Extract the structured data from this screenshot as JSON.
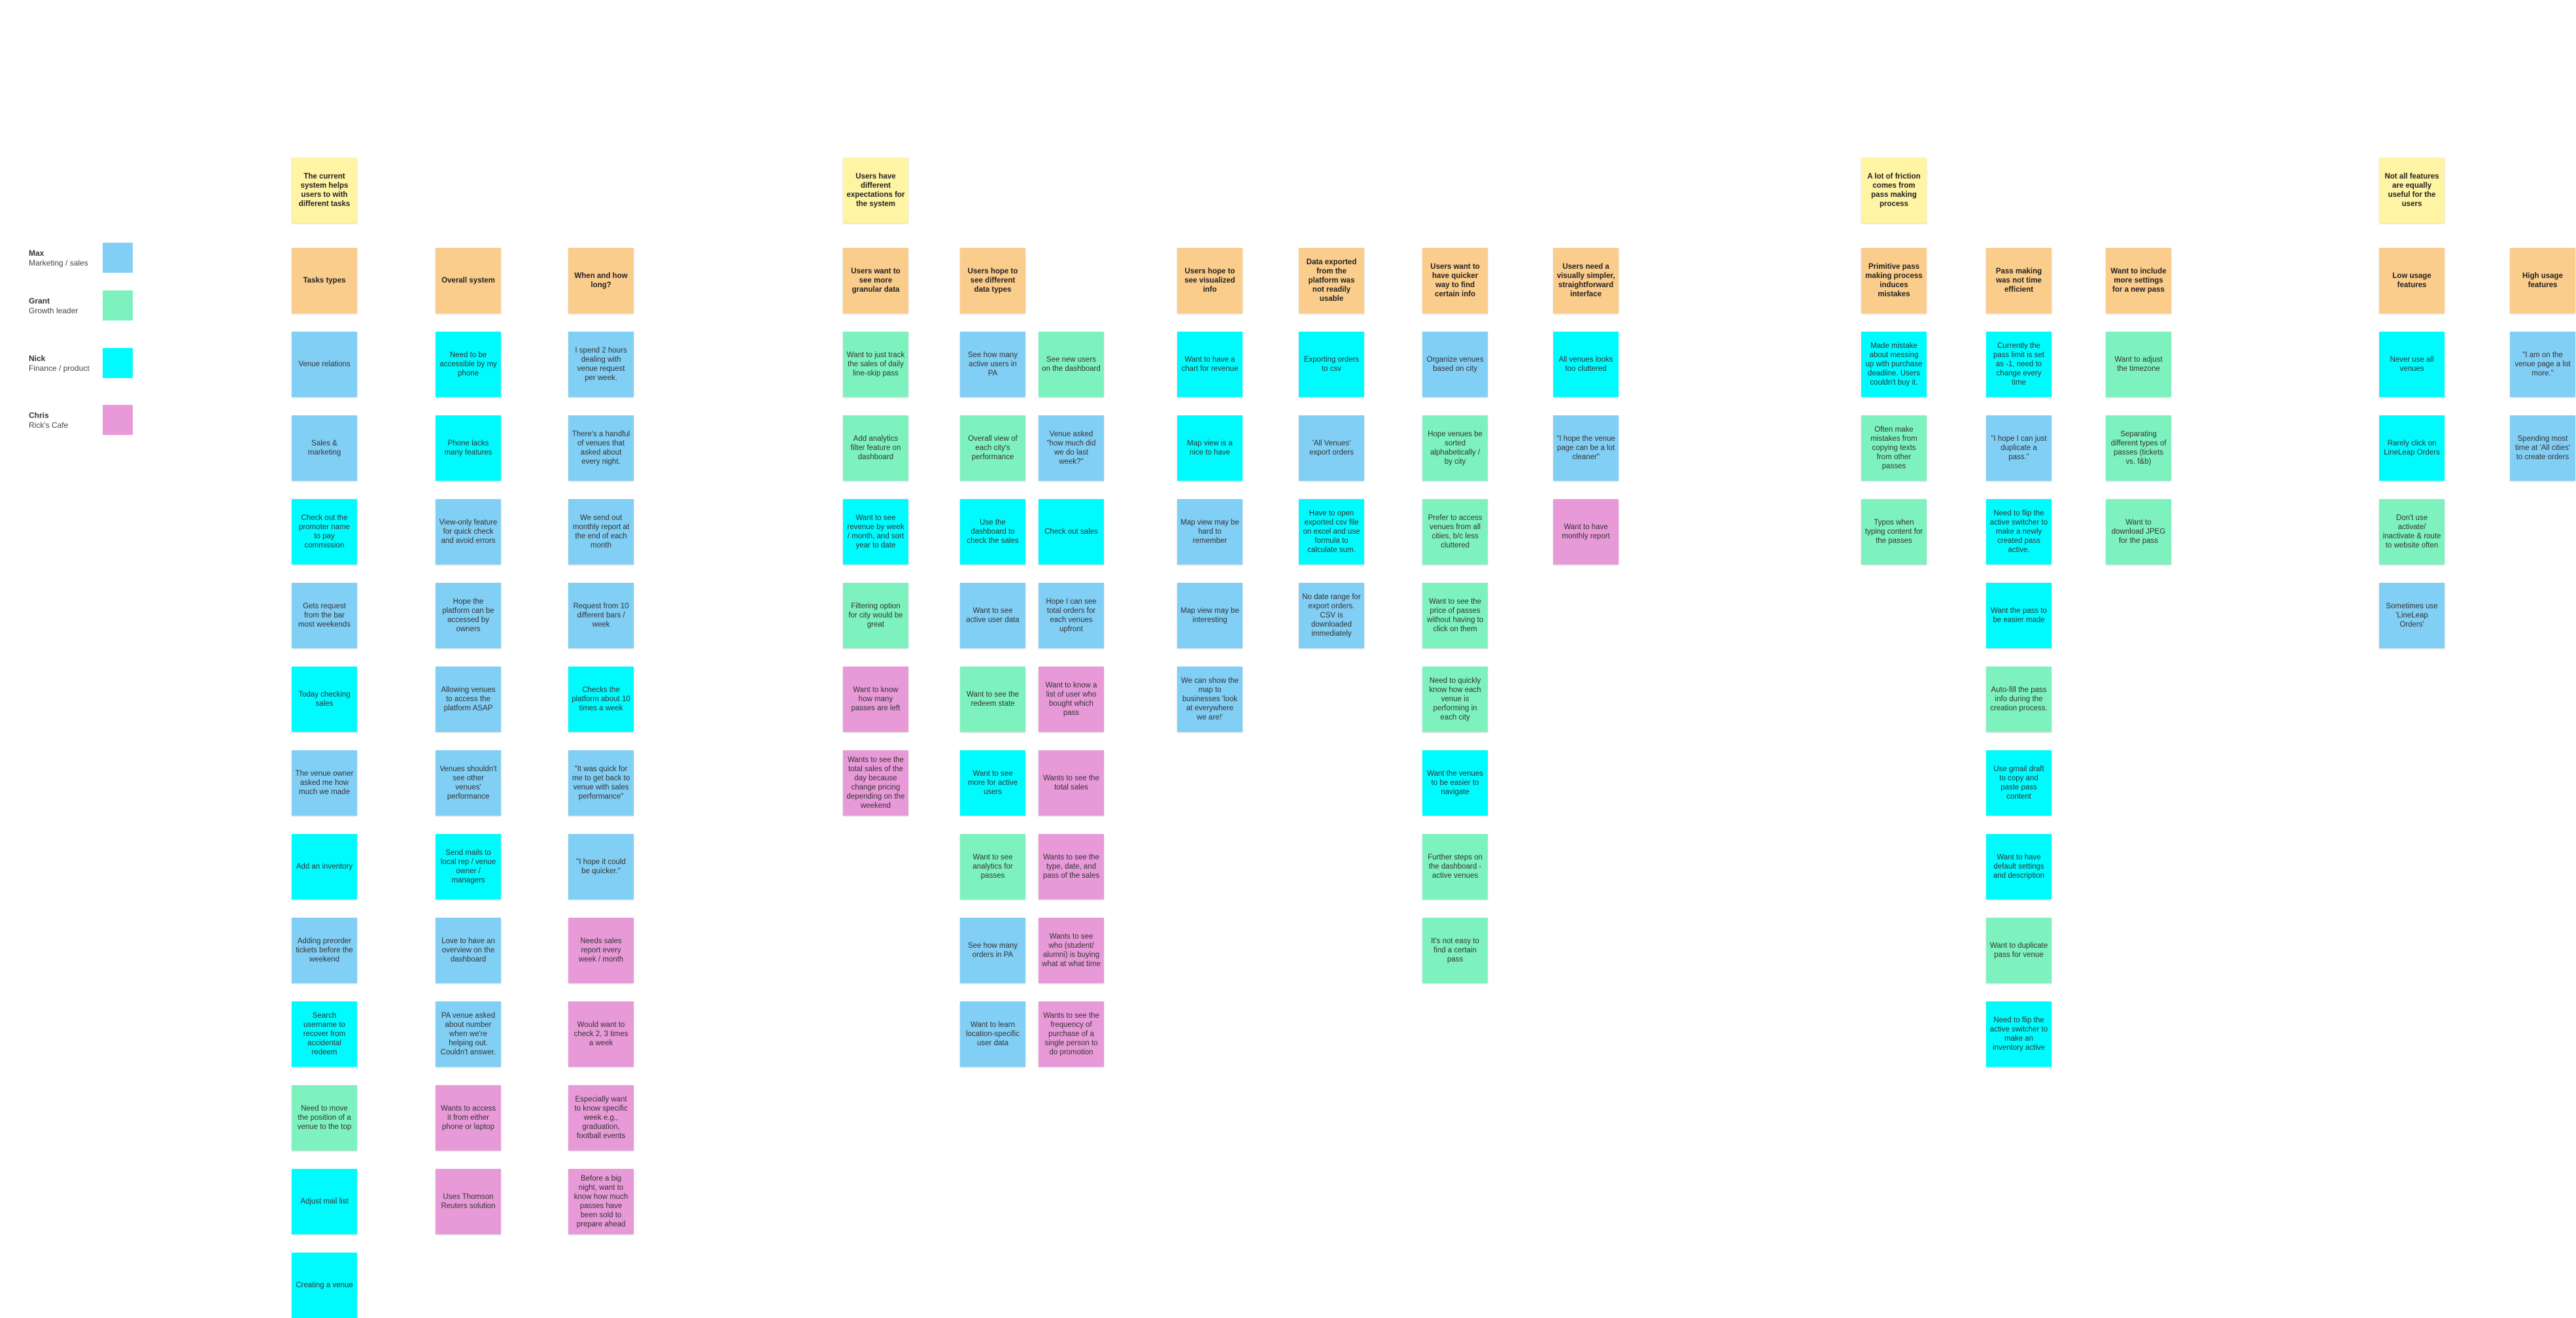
{
  "colors": {
    "theme": "#fff4a3",
    "header": "#fbcd8c",
    "Max": "#82cff5",
    "Grant": "#7ef2be",
    "Nick": "#00fbff",
    "Chris": "#e89ad8"
  },
  "legend": [
    {
      "name": "Max",
      "role": "Marketing / sales",
      "color": "#82cff5"
    },
    {
      "name": "Grant",
      "role": "Growth leader",
      "color": "#7ef2be"
    },
    {
      "name": "Nick",
      "role": "Finance / product",
      "color": "#00fbff"
    },
    {
      "name": "Chris",
      "role": "Rick's Cafe",
      "color": "#e89ad8"
    }
  ],
  "themes": [
    "The current system helps users to with different tasks",
    "Users have different expectations for the system",
    "A lot of friction comes from pass making process",
    "Not all features are equally useful for the users"
  ],
  "columns": [
    {
      "header": "Tasks types",
      "notes": [
        {
          "text": "Venue relations",
          "owner": "Max"
        },
        {
          "text": "Sales & marketing",
          "owner": "Max"
        },
        {
          "text": "Check out the promoter name to pay commission",
          "owner": "Nick"
        },
        {
          "text": "Gets request from the bar most weekends",
          "owner": "Max"
        },
        {
          "text": "Today checking sales",
          "owner": "Nick"
        },
        {
          "text": "The venue owner asked me how much we made",
          "owner": "Max"
        },
        {
          "text": "Add an inventory",
          "owner": "Nick"
        },
        {
          "text": "Adding preorder tickets before the weekend",
          "owner": "Max"
        },
        {
          "text": "Search username to recover from accidental redeem",
          "owner": "Nick"
        },
        {
          "text": "Need to move the position of a venue to the top",
          "owner": "Grant"
        },
        {
          "text": "Adjust mail list",
          "owner": "Nick"
        },
        {
          "text": "Creating a venue",
          "owner": "Nick"
        }
      ]
    },
    {
      "header": "Overall system",
      "notes": [
        {
          "text": "Need to be accessible by my phone",
          "owner": "Nick"
        },
        {
          "text": "Phone lacks many features",
          "owner": "Nick"
        },
        {
          "text": "View-only feature for quick check and avoid errors",
          "owner": "Max"
        },
        {
          "text": "Hope the platform can be accessed by owners",
          "owner": "Max"
        },
        {
          "text": "Allowing venues to access the platform ASAP",
          "owner": "Max"
        },
        {
          "text": "Venues shouldn't see other venues' performance",
          "owner": "Max"
        },
        {
          "text": "Send mails to local rep / venue owner / managers",
          "owner": "Nick"
        },
        {
          "text": "Love to have an overview on the dashboard",
          "owner": "Max"
        },
        {
          "text": "PA venue asked about number when we're helping out. Couldn't answer.",
          "owner": "Max"
        },
        {
          "text": "Wants to access it from either phone or laptop",
          "owner": "Chris"
        },
        {
          "text": "Uses Thomson Reuters solution",
          "owner": "Chris"
        }
      ]
    },
    {
      "header": "When and how long?",
      "notes": [
        {
          "text": "I spend 2 hours dealing with venue request per week.",
          "owner": "Max"
        },
        {
          "text": "There's a handful of venues that asked about every night.",
          "owner": "Max"
        },
        {
          "text": "We send out monthly report at the end of each month",
          "owner": "Max"
        },
        {
          "text": "Request from 10 different bars / week",
          "owner": "Max"
        },
        {
          "text": "Checks the platform about 10 times a week",
          "owner": "Nick"
        },
        {
          "text": "\"It was quick for me to get back to venue with sales performance\"",
          "owner": "Max"
        },
        {
          "text": "\"I hope it could be quicker.\"",
          "owner": "Max"
        },
        {
          "text": "Needs sales report every week / month",
          "owner": "Chris"
        },
        {
          "text": "Would want to check 2, 3 times a week",
          "owner": "Chris"
        },
        {
          "text": "Especially want to know specific week e.g., graduation, football events",
          "owner": "Chris"
        },
        {
          "text": "Before a big night, want to know how much passes have been sold to prepare ahead",
          "owner": "Chris"
        }
      ]
    },
    {
      "header": "Users want to see more granular data",
      "notes": [
        {
          "text": "Want to just track the sales of daily line-skip pass",
          "owner": "Grant"
        },
        {
          "text": "Add analytics filter feature on dashboard",
          "owner": "Grant"
        },
        {
          "text": "Want to see revenue by week / month, and sort year to date",
          "owner": "Nick"
        },
        {
          "text": "Filtering option for city would be great",
          "owner": "Grant"
        },
        {
          "text": "Want to know how many passes are left",
          "owner": "Chris"
        },
        {
          "text": "Wants to see the total sales of the day because change pricing depending on the weekend",
          "owner": "Chris"
        }
      ]
    },
    {
      "header": "Users hope to see different data types",
      "notes": [
        {
          "text": "See how many active users in PA",
          "owner": "Max"
        },
        {
          "text": "Overall view of each city's performance",
          "owner": "Grant"
        },
        {
          "text": "Use the dashboard to check the sales",
          "owner": "Nick"
        },
        {
          "text": "Want to see active user data",
          "owner": "Max"
        },
        {
          "text": "Want to see the redeem state",
          "owner": "Grant"
        },
        {
          "text": "Want to see more for active users",
          "owner": "Nick"
        },
        {
          "text": "Want to see analytics for passes",
          "owner": "Grant"
        },
        {
          "text": "See how many orders in PA",
          "owner": "Max"
        },
        {
          "text": "Want to learn location-specific user data",
          "owner": "Max"
        }
      ]
    },
    {
      "header": "",
      "notes": [
        {
          "text": "See new users on the dashboard",
          "owner": "Grant"
        },
        {
          "text": "Venue asked \"how much did we do last week?\"",
          "owner": "Max"
        },
        {
          "text": "Check out sales",
          "owner": "Nick"
        },
        {
          "text": "Hope I can see total orders for each venues upfront",
          "owner": "Max"
        },
        {
          "text": "Want to know a list of user who bought which pass",
          "owner": "Chris"
        },
        {
          "text": "Wants to see the total sales",
          "owner": "Chris"
        },
        {
          "text": "Wants to see the type, date, and pass of the sales",
          "owner": "Chris"
        },
        {
          "text": "Wants to see who (student/ alumni) is buying what at what time",
          "owner": "Chris"
        },
        {
          "text": "Wants to see the frequency of purchase of a single person to do promotion",
          "owner": "Chris"
        }
      ]
    },
    {
      "header": "Users hope to see visualized info",
      "notes": [
        {
          "text": "Want to have a chart for revenue",
          "owner": "Nick"
        },
        {
          "text": "Map view is a nice to have",
          "owner": "Nick"
        },
        {
          "text": "Map view may be hard to remember",
          "owner": "Max"
        },
        {
          "text": "Map view may be interesting",
          "owner": "Max"
        },
        {
          "text": "We can show the map to businesses 'look at everywhere we are!'",
          "owner": "Max"
        }
      ]
    },
    {
      "header": "Data exported from the platform was not readily usable",
      "notes": [
        {
          "text": "Exporting orders to csv",
          "owner": "Nick"
        },
        {
          "text": "'All Venues' export orders",
          "owner": "Max"
        },
        {
          "text": "Have to open exported csv file on excel and use formula to calculate sum.",
          "owner": "Nick"
        },
        {
          "text": "No date range for export orders. CSV is downloaded immediately",
          "owner": "Max"
        }
      ]
    },
    {
      "header": "Users want to have quicker way to find certain info",
      "notes": [
        {
          "text": "Organize venues based on city",
          "owner": "Max"
        },
        {
          "text": "Hope venues be sorted alphabetically / by city",
          "owner": "Grant"
        },
        {
          "text": "Prefer to access venues from all cities, b/c less cluttered",
          "owner": "Grant"
        },
        {
          "text": "Want to see the price of passes without having to click on them",
          "owner": "Grant"
        },
        {
          "text": "Need to quickly know how each venue is performing in each city",
          "owner": "Grant"
        },
        {
          "text": "Want the venues to be easier to navigate",
          "owner": "Nick"
        },
        {
          "text": "Further steps on the dashboard - active venues",
          "owner": "Grant"
        },
        {
          "text": "It's not easy to find a certain pass",
          "owner": "Grant"
        }
      ]
    },
    {
      "header": "Users need a visually simpler, straightforward interface",
      "notes": [
        {
          "text": "All venues looks too cluttered",
          "owner": "Nick"
        },
        {
          "text": "\"I hope the venue page can be a lot cleaner\"",
          "owner": "Max"
        },
        {
          "text": "Want to have monthly report",
          "owner": "Chris"
        }
      ]
    },
    {
      "header": "Primitive pass making process induces mistakes",
      "notes": [
        {
          "text": "Made mistake about messing up with purchase deadline. Users couldn't buy it.",
          "owner": "Nick"
        },
        {
          "text": "Often make mistakes from copying texts from other passes",
          "owner": "Grant"
        },
        {
          "text": "Typos when typing content for the passes",
          "owner": "Grant"
        }
      ]
    },
    {
      "header": "Pass making was not time efficient",
      "notes": [
        {
          "text": "Currently the pass limit is set as -1, need to change every time",
          "owner": "Nick"
        },
        {
          "text": "\"I hope I can just duplicate a pass.\"",
          "owner": "Max"
        },
        {
          "text": "Need to flip the active switcher to make a newly created pass active.",
          "owner": "Nick"
        },
        {
          "text": "Want the pass to be easier made",
          "owner": "Nick"
        },
        {
          "text": "Auto-fill the pass info during the creation process.",
          "owner": "Grant"
        },
        {
          "text": "Use gmail draft to copy and paste pass content",
          "owner": "Nick"
        },
        {
          "text": "Want to have default settings and description",
          "owner": "Nick"
        },
        {
          "text": "Want to duplicate pass for venue",
          "owner": "Grant"
        },
        {
          "text": "Need to flip the active switcher to make an inventory active",
          "owner": "Nick"
        }
      ]
    },
    {
      "header": "Want to include more settings for a new pass",
      "notes": [
        {
          "text": "Want to adjust the timezone",
          "owner": "Grant"
        },
        {
          "text": "Separating different types of passes (tickets vs. f&b)",
          "owner": "Grant"
        },
        {
          "text": "Want to download JPEG for the pass",
          "owner": "Grant"
        }
      ]
    },
    {
      "header": "Low usage features",
      "notes": [
        {
          "text": "Never use all venues",
          "owner": "Nick"
        },
        {
          "text": "Rarely click on LineLeap Orders",
          "owner": "Nick"
        },
        {
          "text": "Don't use activate/ inactivate & route to website often",
          "owner": "Grant"
        },
        {
          "text": "Sometimes use 'LineLeap Orders'",
          "owner": "Max"
        }
      ]
    },
    {
      "header": "High usage features",
      "notes": [
        {
          "text": "\"I am on the venue page a lot more.\"",
          "owner": "Max"
        },
        {
          "text": "Spending most time at 'All cities' to create orders",
          "owner": "Max"
        }
      ]
    }
  ]
}
